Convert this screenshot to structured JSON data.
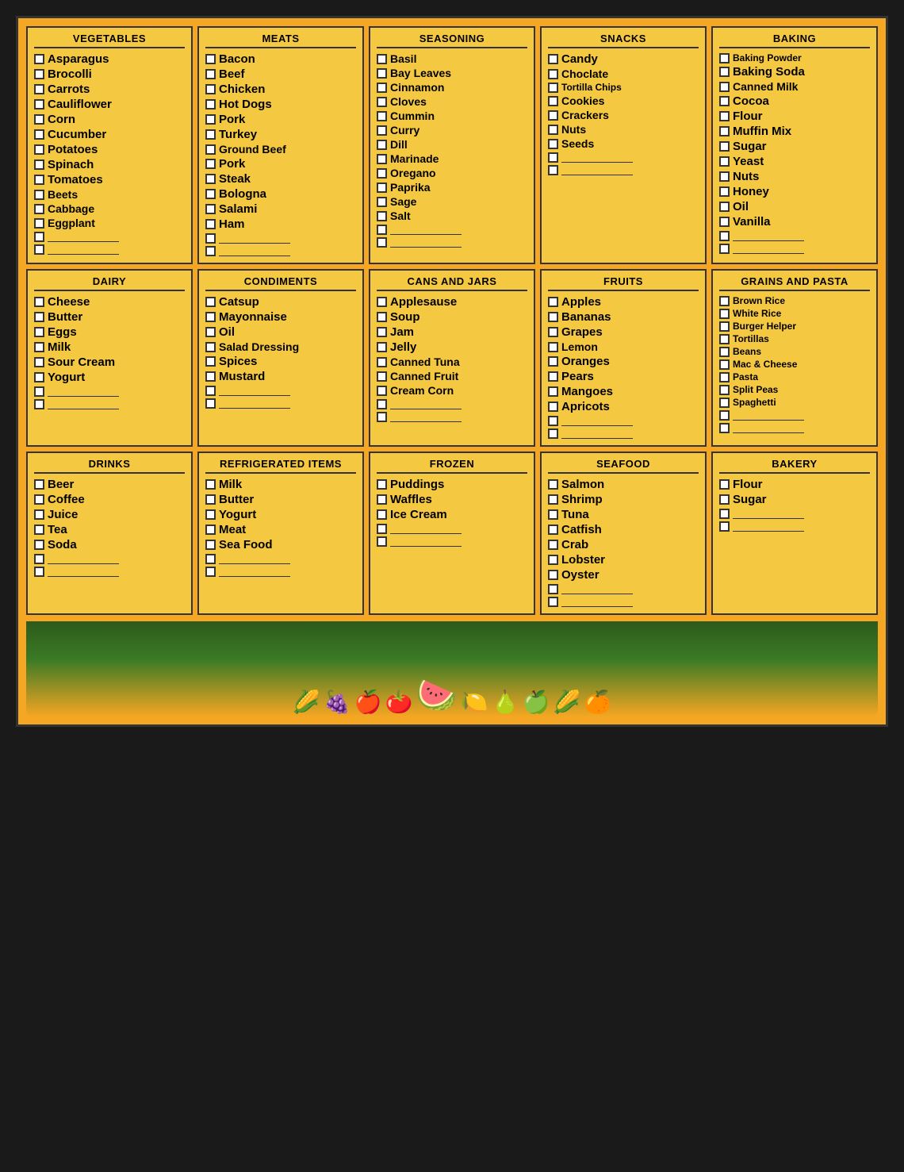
{
  "sections": {
    "vegetables": {
      "title": "VEGETABLES",
      "items": [
        "Asparagus",
        "Brocolli",
        "Carrots",
        "Cauliflower",
        "Corn",
        "Cucumber",
        "Potatoes",
        "Spinach",
        "Tomatoes",
        "Beets",
        "Cabbage",
        "Eggplant"
      ],
      "blanks": 2,
      "sizes": [
        "large",
        "large",
        "large",
        "large",
        "large",
        "large",
        "large",
        "large",
        "large",
        "medium",
        "medium",
        "medium"
      ]
    },
    "meats": {
      "title": "MEATS",
      "items": [
        "Bacon",
        "Beef",
        "Chicken",
        "Hot Dogs",
        "Pork",
        "Turkey",
        "Ground Beef",
        "Pork",
        "Steak",
        "Bologna",
        "Salami",
        "Ham"
      ],
      "blanks": 2,
      "sizes": [
        "large",
        "large",
        "large",
        "large",
        "large",
        "large",
        "medium",
        "large",
        "large",
        "large",
        "large",
        "large"
      ]
    },
    "seasoning": {
      "title": "SEASONING",
      "items": [
        "Basil",
        "Bay Leaves",
        "Cinnamon",
        "Cloves",
        "Cummin",
        "Curry",
        "Dill",
        "Marinade",
        "Oregano",
        "Paprika",
        "Sage",
        "Salt"
      ],
      "blanks": 2,
      "sizes": [
        "medium",
        "medium",
        "medium",
        "medium",
        "medium",
        "medium",
        "medium",
        "medium",
        "medium",
        "medium",
        "medium",
        "medium"
      ]
    },
    "snacks": {
      "title": "SNACKS",
      "items": [
        "Candy",
        "Choclate",
        "Tortilla Chips",
        "Cookies",
        "Crackers",
        "Nuts",
        "Seeds"
      ],
      "blanks": 2,
      "sizes": [
        "large",
        "medium",
        "small",
        "medium",
        "medium",
        "medium",
        "medium"
      ]
    },
    "baking": {
      "title": "BAKING",
      "items": [
        "Baking Powder",
        "Baking Soda",
        "Canned Milk",
        "Cocoa",
        "Flour",
        "Muffin Mix",
        "Sugar",
        "Yeast",
        "Nuts",
        "Honey",
        "Oil",
        "Vanilla"
      ],
      "blanks": 2,
      "sizes": [
        "small",
        "large",
        "medium",
        "large",
        "large",
        "large",
        "large",
        "large",
        "large",
        "large",
        "large",
        "large"
      ]
    },
    "dairy": {
      "title": "DAIRY",
      "items": [
        "Cheese",
        "Butter",
        "Eggs",
        "Milk",
        "Sour Cream",
        "Yogurt"
      ],
      "blanks": 2,
      "sizes": [
        "large",
        "large",
        "large",
        "large",
        "large",
        "large"
      ]
    },
    "condiments": {
      "title": "CONDIMENTS",
      "items": [
        "Catsup",
        "Mayonnaise",
        "Oil",
        "Salad Dressing",
        "Spices",
        "Mustard"
      ],
      "blanks": 2,
      "sizes": [
        "large",
        "large",
        "large",
        "medium",
        "large",
        "large"
      ]
    },
    "cansandjars": {
      "title": "CANS AND JARS",
      "items": [
        "Applesause",
        "Soup",
        "Jam",
        "Jelly",
        "Canned Tuna",
        "Canned Fruit",
        "Cream Corn"
      ],
      "blanks": 2,
      "sizes": [
        "large",
        "large",
        "large",
        "large",
        "medium",
        "medium",
        "medium"
      ]
    },
    "fruits": {
      "title": "FRUITS",
      "items": [
        "Apples",
        "Bananas",
        "Grapes",
        "Lemon",
        "Oranges",
        "Pears",
        "Mangoes",
        "Apricots"
      ],
      "blanks": 2,
      "sizes": [
        "large",
        "large",
        "large",
        "medium",
        "large",
        "large",
        "large",
        "large"
      ]
    },
    "grainsandpasta": {
      "title": "GRAINS AND PASTA",
      "items": [
        "Brown Rice",
        "White Rice",
        "Burger Helper",
        "Tortillas",
        "Beans",
        "Mac & Cheese",
        "Pasta",
        "Split Peas",
        "Spaghetti"
      ],
      "blanks": 2,
      "sizes": [
        "small",
        "small",
        "small",
        "small",
        "small",
        "small",
        "small",
        "small",
        "small"
      ]
    },
    "drinks": {
      "title": "DRINKS",
      "items": [
        "Beer",
        "Coffee",
        "Juice",
        "Tea",
        "Soda"
      ],
      "blanks": 2,
      "sizes": [
        "large",
        "large",
        "large",
        "large",
        "large"
      ]
    },
    "refrigerateditems": {
      "title": "REFRIGERATED ITEMS",
      "items": [
        "Milk",
        "Butter",
        "Yogurt",
        "Meat",
        "Sea Food"
      ],
      "blanks": 2,
      "sizes": [
        "large",
        "large",
        "large",
        "large",
        "large"
      ]
    },
    "frozen": {
      "title": "FROZEN",
      "items": [
        "Puddings",
        "Waffles",
        "Ice Cream"
      ],
      "blanks": 2,
      "sizes": [
        "large",
        "large",
        "large"
      ]
    },
    "seafood": {
      "title": "SEAFOOD",
      "items": [
        "Salmon",
        "Shrimp",
        "Tuna",
        "Catfish",
        "Crab",
        "Lobster",
        "Oyster"
      ],
      "blanks": 2,
      "sizes": [
        "large",
        "large",
        "large",
        "large",
        "large",
        "large",
        "large"
      ]
    },
    "bakery": {
      "title": "BAKERY",
      "items": [
        "Flour",
        "Sugar"
      ],
      "blanks": 2,
      "sizes": [
        "large",
        "large"
      ]
    }
  }
}
